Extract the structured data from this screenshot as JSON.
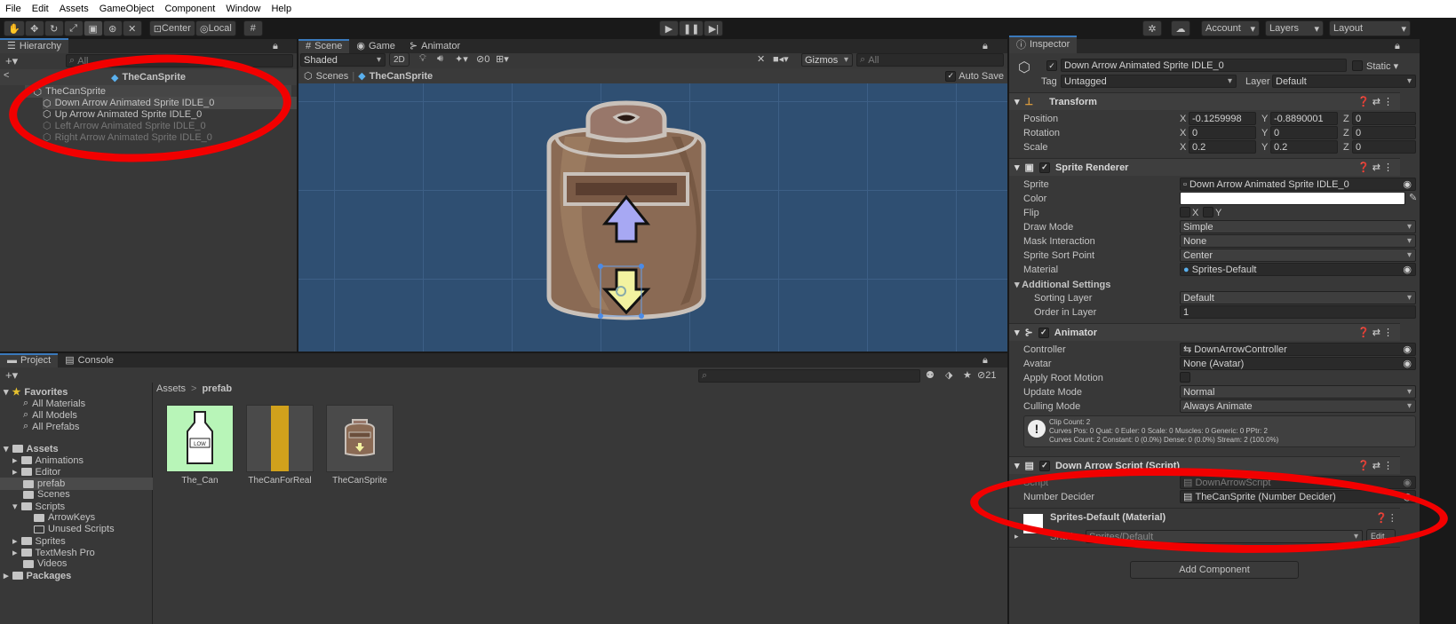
{
  "menu": [
    "File",
    "Edit",
    "Assets",
    "GameObject",
    "Component",
    "Window",
    "Help"
  ],
  "toolbar": {
    "pivot": "Center",
    "space": "Local",
    "account": "Account",
    "layers": "Layers",
    "layout": "Layout"
  },
  "hierarchy": {
    "tab": "Hierarchy",
    "search_placeholder": "All",
    "scene_title": "TheCanSprite",
    "root": "TheCanSprite",
    "children": [
      "Down Arrow Animated Sprite IDLE_0",
      "Up Arrow Animated Sprite IDLE_0",
      "Left Arrow Animated Sprite IDLE_0",
      "Right Arrow Animated Sprite IDLE_0"
    ]
  },
  "scene": {
    "tabs": [
      "Scene",
      "Game",
      "Animator"
    ],
    "shading": "Shaded",
    "mode_2d": "2D",
    "hidden_count": "0",
    "gizmos": "Gizmos",
    "search_placeholder": "All",
    "breadcrumb_root": "Scenes",
    "breadcrumb_item": "TheCanSprite",
    "auto_save": "Auto Save"
  },
  "project": {
    "tabs": [
      "Project",
      "Console"
    ],
    "hidden_count": "21",
    "breadcrumb": [
      "Assets",
      "prefab"
    ],
    "favorites_label": "Favorites",
    "favorites": [
      "All Materials",
      "All Models",
      "All Prefabs"
    ],
    "assets_label": "Assets",
    "folders": [
      "Animations",
      "Editor",
      "prefab",
      "Scenes",
      "Scripts",
      "ArrowKeys",
      "Unused Scripts",
      "Sprites",
      "TextMesh Pro",
      "Videos"
    ],
    "packages": "Packages",
    "items": [
      "The_Can",
      "TheCanForReal",
      "TheCanSprite"
    ],
    "milk_label": "LOW"
  },
  "inspector": {
    "tab": "Inspector",
    "name": "Down Arrow Animated Sprite IDLE_0",
    "static": "Static",
    "tag_label": "Tag",
    "tag": "Untagged",
    "layer_label": "Layer",
    "layer": "Default",
    "transform": {
      "title": "Transform",
      "position_label": "Position",
      "rotation_label": "Rotation",
      "scale_label": "Scale",
      "position": {
        "x": "-0.1259998",
        "y": "-0.8890001",
        "z": "0"
      },
      "rotation": {
        "x": "0",
        "y": "0",
        "z": "0"
      },
      "scale": {
        "x": "0.2",
        "y": "0.2",
        "z": "0"
      }
    },
    "sprite_renderer": {
      "title": "Sprite Renderer",
      "labels": [
        "Sprite",
        "Color",
        "Flip",
        "Draw Mode",
        "Mask Interaction",
        "Sprite Sort Point",
        "Material"
      ],
      "sprite": "Down Arrow Animated Sprite IDLE_0",
      "flip_x": "X",
      "flip_y": "Y",
      "draw_mode": "Simple",
      "mask_interaction": "None",
      "sort_point": "Center",
      "material": "Sprites-Default",
      "additional": "Additional Settings",
      "sorting_layer_label": "Sorting Layer",
      "sorting_layer": "Default",
      "order_label": "Order in Layer",
      "order": "1"
    },
    "animator": {
      "title": "Animator",
      "labels": [
        "Controller",
        "Avatar",
        "Apply Root Motion",
        "Update Mode",
        "Culling Mode"
      ],
      "controller": "DownArrowController",
      "avatar": "None (Avatar)",
      "update_mode": "Normal",
      "culling_mode": "Always Animate",
      "info1": "Clip Count: 2",
      "info2": "Curves Pos: 0 Quat: 0 Euler: 0 Scale: 0 Muscles: 0 Generic: 0 PPtr: 2",
      "info3": "Curves Count: 2 Constant: 0 (0.0%) Dense: 0 (0.0%) Stream: 2 (100.0%)"
    },
    "script": {
      "title": "Down Arrow Script (Script)",
      "script_label": "Script",
      "script_value": "DownArrowScript",
      "decider_label": "Number Decider",
      "decider_value": "TheCanSprite (Number Decider)"
    },
    "material": {
      "title": "Sprites-Default (Material)",
      "shader_label": "Shader",
      "shader": "Sprites/Default",
      "edit": "Edit..."
    },
    "add_component": "Add Component"
  },
  "colors": {
    "accent": "#3a79bb",
    "annotation": "#f20000",
    "scene_bg": "#2f4f72"
  }
}
